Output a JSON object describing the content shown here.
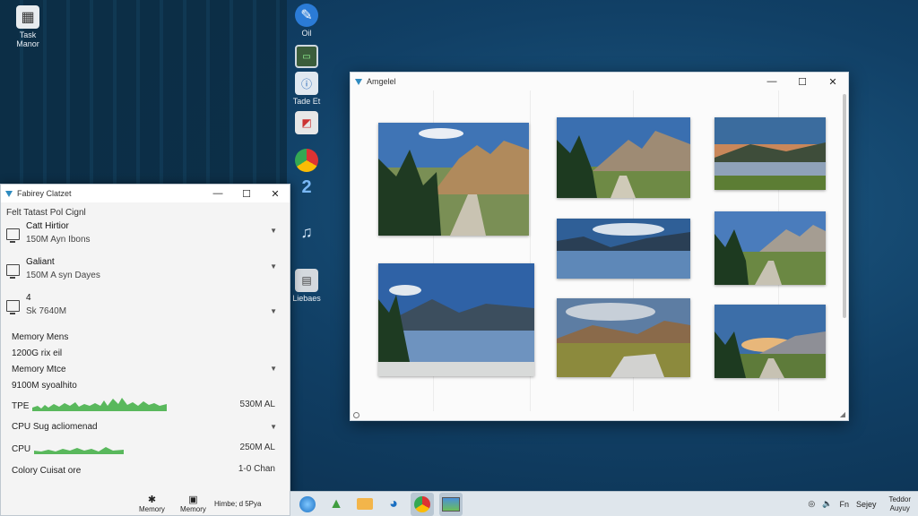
{
  "desktop": {
    "icons": [
      {
        "label": "Task Manor",
        "name": "task-manager-icon"
      },
      {
        "label": "Oil",
        "name": "app-globe-icon"
      },
      {
        "label": "Tade Et",
        "name": "terminal-icon"
      },
      {
        "label": "",
        "name": "photo-viewer-icon"
      },
      {
        "label": "",
        "name": "chrome-icon"
      },
      {
        "label": "",
        "name": "number-two-icon"
      },
      {
        "label": "",
        "name": "music-icon"
      },
      {
        "label": "Liebaes",
        "name": "libraries-icon"
      }
    ]
  },
  "photo_window": {
    "title": "Amgelel",
    "minimize": "—",
    "maximize": "☐",
    "close": "✕"
  },
  "task_window": {
    "title": "Fabirey Clatzet",
    "minimize": "—",
    "maximize": "☐",
    "close": "✕",
    "subtitle": "Felt Tatast Pol Cignl",
    "processes": [
      {
        "name": "Catt Hirtior",
        "detail": "150M Ayn Ibons"
      },
      {
        "name": "Galiant",
        "detail": "150M A syn Dayes"
      },
      {
        "name": "4",
        "detail": "Sk 7640M"
      }
    ],
    "memory": [
      {
        "label": "Memory Mens",
        "value": "1200G rix eil"
      },
      {
        "label": "Memory Mtce",
        "value": "9100M syoalhito"
      }
    ],
    "graph1": {
      "label": "TPE",
      "right": "530M AL"
    },
    "cpu_header": "CPU Sug acliomenad",
    "graph2": {
      "label": "CPU",
      "right": "250M AL"
    },
    "summary": {
      "label": "Colory Cuisat ore",
      "right": "1-0 Chan"
    },
    "footer": [
      {
        "label": "Memory",
        "icon": "gear-icon"
      },
      {
        "label": "Memory",
        "icon": "chart-icon"
      },
      {
        "label": "Himbe; d 5Pya",
        "icon": ""
      }
    ]
  },
  "taskbar": {
    "apps": [
      "windows-icon",
      "folder-green-icon",
      "folder-icon",
      "globe-icon",
      "chrome-icon",
      "photos-icon"
    ],
    "tray": {
      "wifi": "◎",
      "sound": "🔈",
      "lang": "Fn",
      "tray_text": "Sejey",
      "clock_line1": "Teddor",
      "clock_line2": "Auyuy"
    }
  },
  "colors": {
    "accent_green": "#4caf50",
    "window_bg": "#fbfbfb",
    "desktop_blue": "#114066"
  }
}
